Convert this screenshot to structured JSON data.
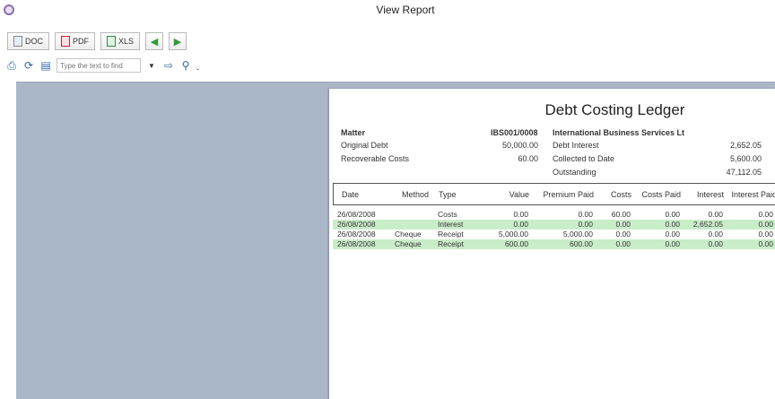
{
  "window": {
    "title": "View Report"
  },
  "export_toolbar": {
    "doc_label": "DOC",
    "pdf_label": "PDF",
    "xls_label": "XLS"
  },
  "search": {
    "placeholder": "Type the text to find"
  },
  "report": {
    "title": "Debt Costing Ledger",
    "matter_label": "Matter",
    "matter_value": "IBS001/0008",
    "client_name": "International Business Services Lt",
    "original_debt_label": "Original Debt",
    "original_debt_value": "50,000.00",
    "debt_interest_label": "Debt Interest",
    "debt_interest_value": "2,652.05",
    "recoverable_costs_label": "Recoverable Costs",
    "recoverable_costs_value": "60.00",
    "collected_label": "Collected to Date",
    "collected_value": "5,600.00",
    "outstanding_label": "Outstanding",
    "outstanding_value": "47,112.05"
  },
  "table": {
    "headers": {
      "date": "Date",
      "method": "Method",
      "type": "Type",
      "value": "Value",
      "premium_paid": "Premium Paid",
      "costs": "Costs",
      "costs_paid": "Costs Paid",
      "interest": "Interest",
      "interest_paid": "Interest Paid"
    },
    "rows": [
      {
        "date": "26/08/2008",
        "method": "",
        "type": "Costs",
        "value": "0.00",
        "premium_paid": "0.00",
        "costs": "60.00",
        "costs_paid": "0.00",
        "interest": "0.00",
        "interest_paid": "0.00",
        "highlight": false
      },
      {
        "date": "26/08/2008",
        "method": "",
        "type": "Interest",
        "value": "0.00",
        "premium_paid": "0.00",
        "costs": "0.00",
        "costs_paid": "0.00",
        "interest": "2,652.05",
        "interest_paid": "0.00",
        "highlight": true
      },
      {
        "date": "26/08/2008",
        "method": "Cheque",
        "type": "Receipt",
        "value": "5,000.00",
        "premium_paid": "5,000.00",
        "costs": "0.00",
        "costs_paid": "0.00",
        "interest": "0.00",
        "interest_paid": "0.00",
        "highlight": false
      },
      {
        "date": "26/08/2008",
        "method": "Cheque",
        "type": "Receipt",
        "value": "600.00",
        "premium_paid": "600.00",
        "costs": "0.00",
        "costs_paid": "0.00",
        "interest": "0.00",
        "interest_paid": "0.00",
        "highlight": true
      }
    ]
  },
  "colors": {
    "viewer_bg": "#aab7c8",
    "row_highlight": "#c9ecc9"
  }
}
